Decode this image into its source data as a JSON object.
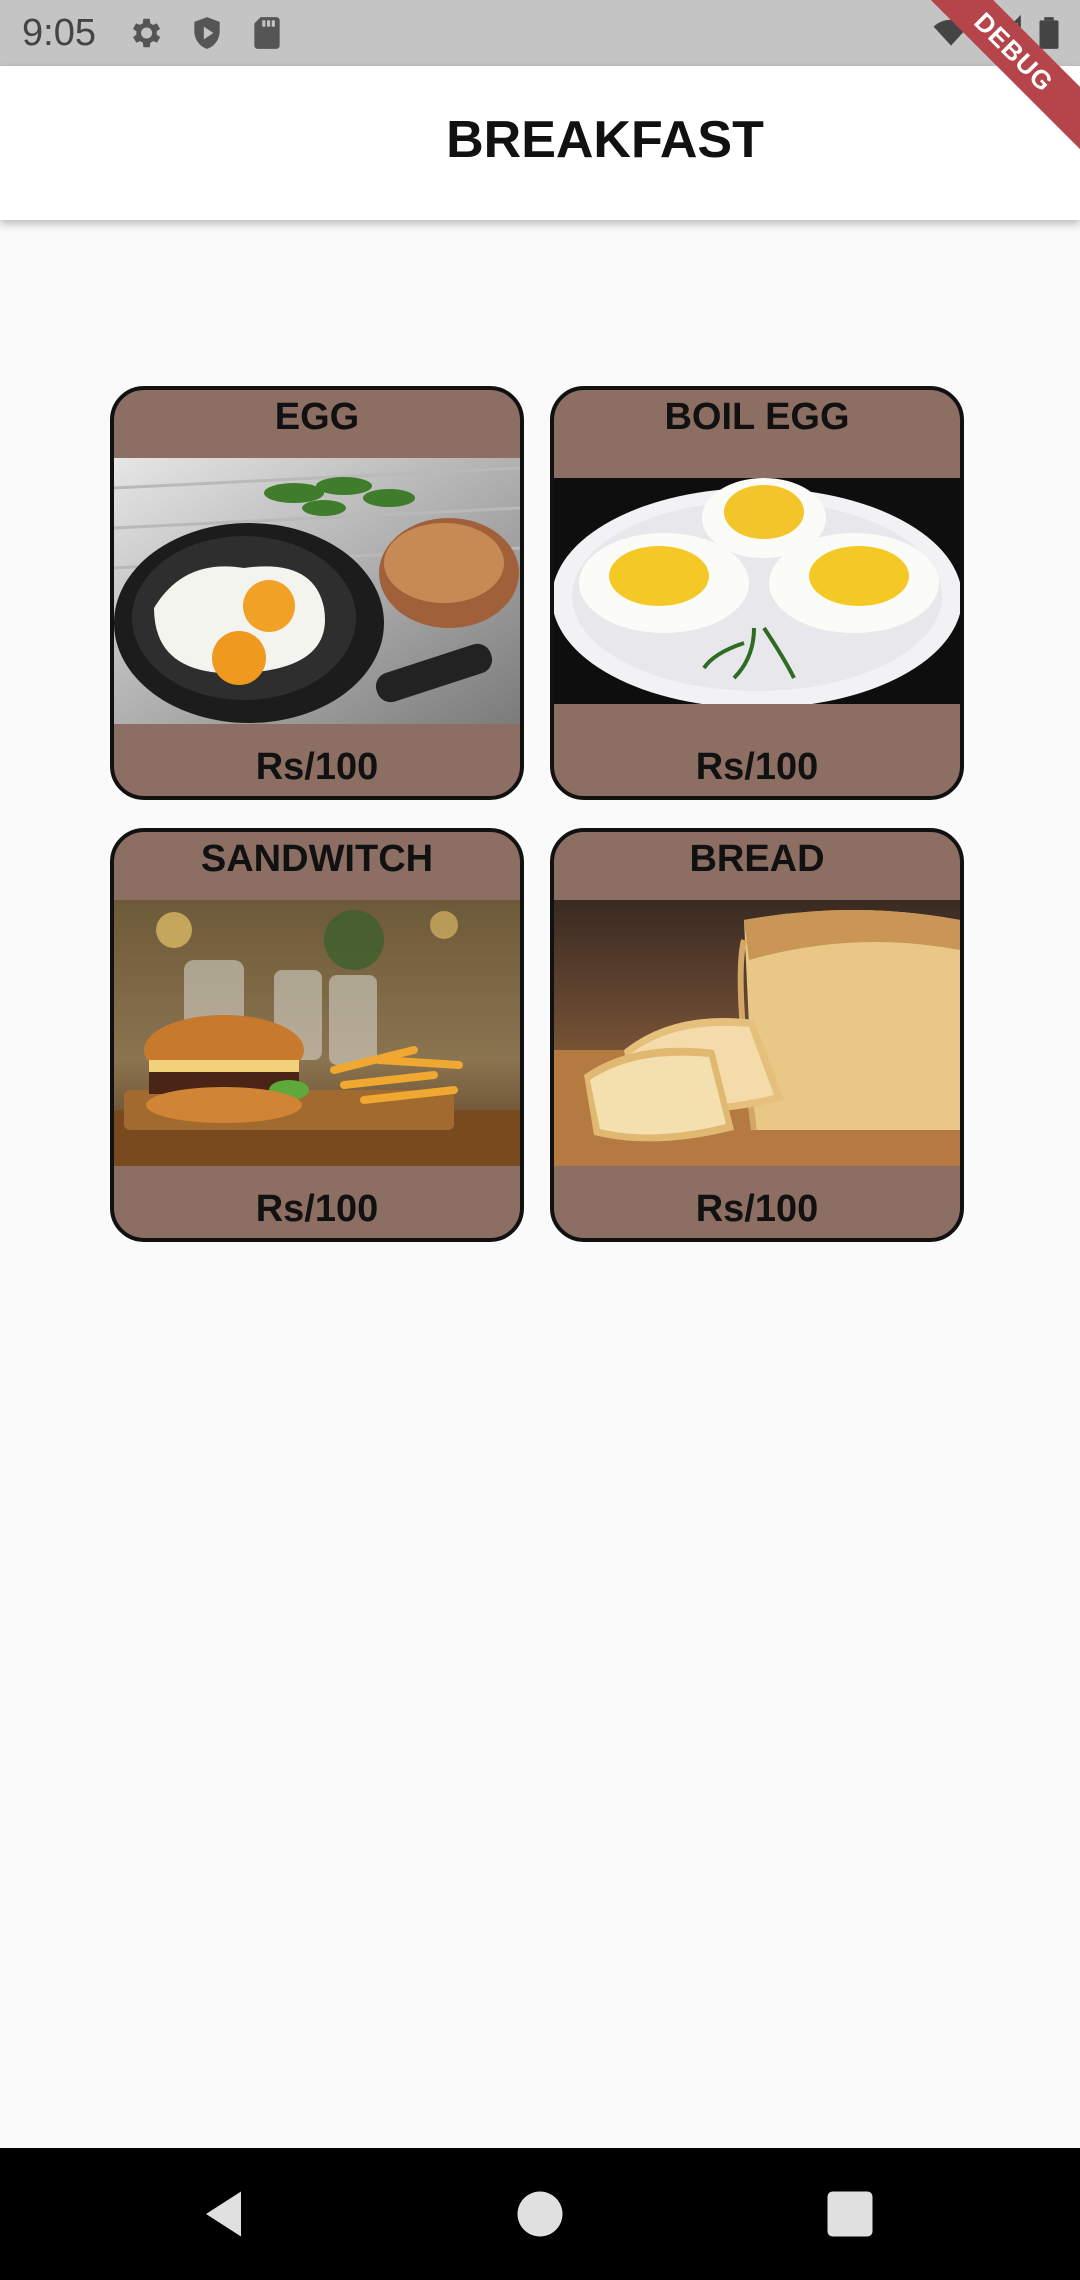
{
  "status_bar": {
    "time": "9:05",
    "left_icons": [
      "settings-icon",
      "shield-icon",
      "sd-card-icon"
    ],
    "right_icons": [
      "wifi-icon",
      "signal-icon",
      "battery-icon"
    ],
    "debug_label": "DEBUG"
  },
  "app_bar": {
    "title": "BREAKFAST"
  },
  "items": [
    {
      "title": "EGG",
      "price": "Rs/100",
      "image": "fried-egg-in-pan"
    },
    {
      "title": "BOIL EGG",
      "price": "Rs/100",
      "image": "boiled-eggs-plate"
    },
    {
      "title": "SANDWITCH",
      "price": "Rs/100",
      "image": "burger-and-fries"
    },
    {
      "title": "BREAD",
      "price": "Rs/100",
      "image": "sliced-bread-loaf"
    }
  ],
  "nav_bar": {
    "buttons": [
      "back-icon",
      "home-icon",
      "recents-icon"
    ]
  },
  "colors": {
    "card_background": "#8d6e63",
    "card_border": "#111111",
    "status_bar": "#c4c4c4",
    "debug_ribbon": "#b5454a"
  }
}
